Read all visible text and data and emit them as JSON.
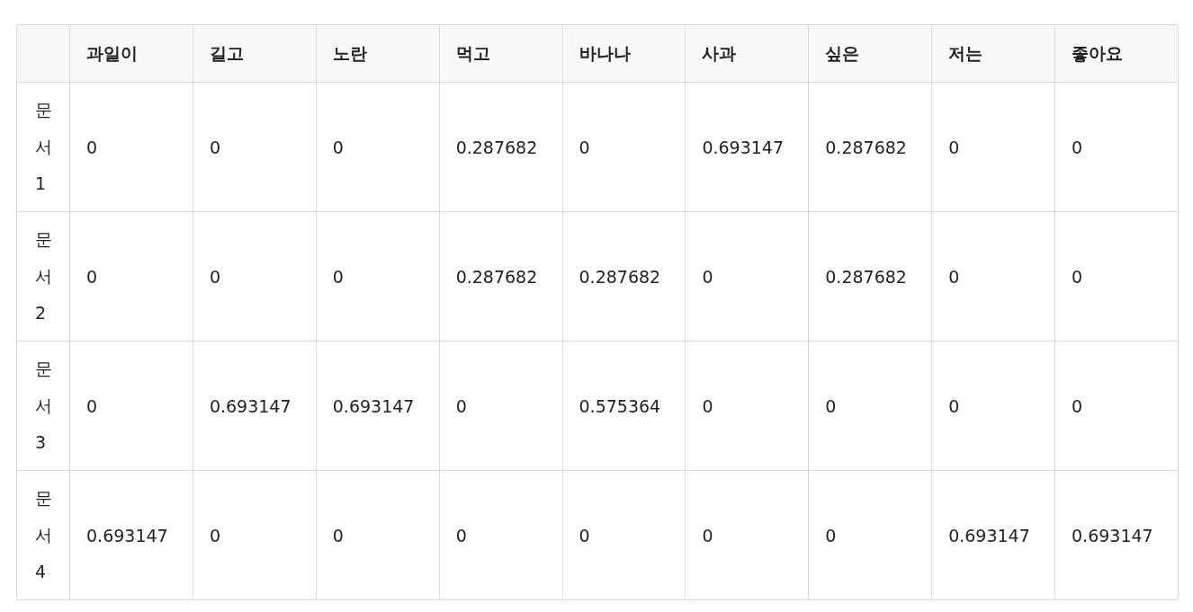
{
  "table": {
    "columns": [
      "과일이",
      "길고",
      "노란",
      "먹고",
      "바나나",
      "사과",
      "싶은",
      "저는",
      "좋아요"
    ],
    "rows": [
      {
        "label": "문서1",
        "cells": [
          "0",
          "0",
          "0",
          "0.287682",
          "0",
          "0.693147",
          "0.287682",
          "0",
          "0"
        ]
      },
      {
        "label": "문서2",
        "cells": [
          "0",
          "0",
          "0",
          "0.287682",
          "0.287682",
          "0",
          "0.287682",
          "0",
          "0"
        ]
      },
      {
        "label": "문서3",
        "cells": [
          "0",
          "0.693147",
          "0.693147",
          "0",
          "0.575364",
          "0",
          "0",
          "0",
          "0"
        ]
      },
      {
        "label": "문서4",
        "cells": [
          "0.693147",
          "0",
          "0",
          "0",
          "0",
          "0",
          "0",
          "0.693147",
          "0.693147"
        ]
      }
    ]
  }
}
